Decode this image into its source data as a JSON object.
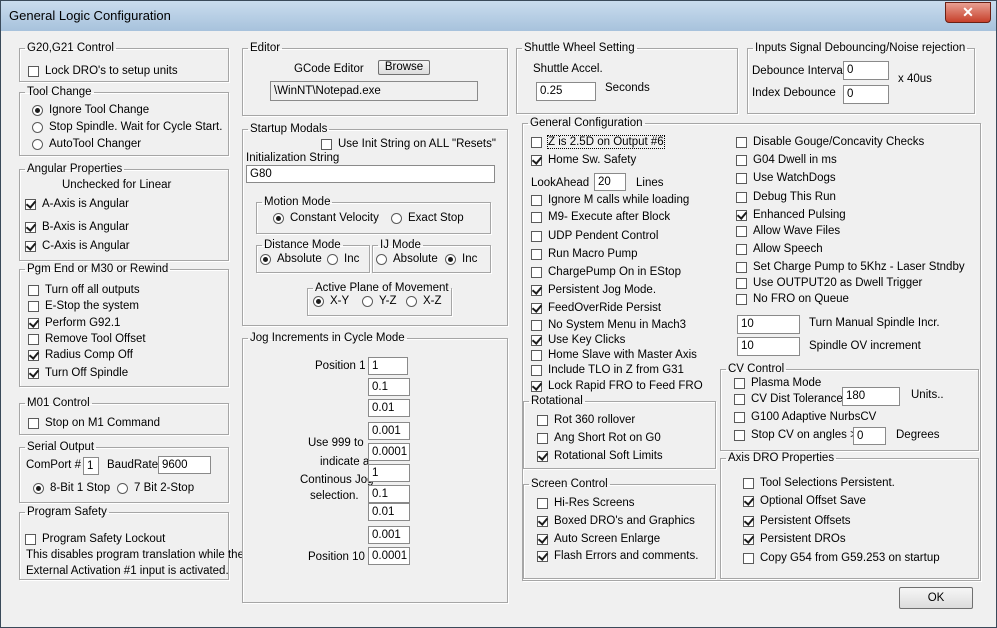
{
  "window": {
    "title": "General Logic Configuration",
    "close_label": "✕"
  },
  "g20": {
    "title": "G20,G21 Control",
    "lock_label": "Lock DRO's to setup units",
    "lock_checked": false
  },
  "toolchange": {
    "title": "Tool Change",
    "options": [
      {
        "label": "Ignore Tool Change",
        "selected": true
      },
      {
        "label": "Stop Spindle. Wait for Cycle Start.",
        "selected": false
      },
      {
        "label": "AutoTool Changer",
        "selected": false
      }
    ]
  },
  "angular": {
    "title": "Angular Properties",
    "note": "Unchecked for Linear",
    "items": [
      {
        "label": "A-Axis is Angular",
        "checked": true
      },
      {
        "label": "B-Axis is Angular",
        "checked": true
      },
      {
        "label": "C-Axis is Angular",
        "checked": true
      }
    ]
  },
  "pgmend": {
    "title": "Pgm End or M30 or Rewind",
    "items": [
      {
        "label": "Turn off all outputs",
        "checked": false
      },
      {
        "label": "E-Stop the system",
        "checked": false
      },
      {
        "label": "Perform G92.1",
        "checked": true
      },
      {
        "label": "Remove Tool Offset",
        "checked": false
      },
      {
        "label": "Radius Comp Off",
        "checked": true
      },
      {
        "label": "Turn Off Spindle",
        "checked": true
      }
    ]
  },
  "m01": {
    "title": "M01 Control",
    "label": "Stop on M1 Command",
    "checked": false
  },
  "serial": {
    "title": "Serial Output",
    "comport_label": "ComPort #",
    "comport_value": "1",
    "baud_label": "BaudRate",
    "baud_value": "9600",
    "options": [
      {
        "label": "8-Bit 1 Stop",
        "selected": true
      },
      {
        "label": "7 Bit 2-Stop",
        "selected": false
      }
    ]
  },
  "safety": {
    "title": "Program Safety",
    "label": "Program Safety Lockout",
    "checked": false,
    "note1": "This disables program translation while the",
    "note2": "External Activation #1 input is activated."
  },
  "editor": {
    "title": "Editor",
    "label": "GCode Editor",
    "browse_label": "Browse",
    "path": "\\WinNT\\Notepad.exe"
  },
  "startup": {
    "title": "Startup Modals",
    "init_all_label": "Use Init String on ALL  \"Resets\"",
    "init_all_checked": false,
    "init_label": "Initialization String",
    "init_value": "G80",
    "motion": {
      "title": "Motion Mode",
      "options": [
        {
          "label": "Constant Velocity",
          "selected": true
        },
        {
          "label": "Exact Stop",
          "selected": false
        }
      ]
    },
    "distance": {
      "title": "Distance Mode",
      "options": [
        {
          "label": "Absolute",
          "selected": true
        },
        {
          "label": "Inc",
          "selected": false
        }
      ]
    },
    "ij": {
      "title": "IJ Mode",
      "options": [
        {
          "label": "Absolute",
          "selected": false
        },
        {
          "label": "Inc",
          "selected": true
        }
      ]
    },
    "plane": {
      "title": "Active Plane of Movement",
      "options": [
        {
          "label": "X-Y",
          "selected": true
        },
        {
          "label": "Y-Z",
          "selected": false
        },
        {
          "label": "X-Z",
          "selected": false
        }
      ]
    }
  },
  "jog": {
    "title": "Jog Increments in Cycle Mode",
    "pos1_label": "Position 1",
    "pos10_label": "Position 10",
    "note": [
      "Use 999 to",
      "indicate a",
      "Continous Jog",
      "selection."
    ],
    "values": [
      "1",
      "0.1",
      "0.01",
      "0.001",
      "0.0001",
      "1",
      "0.1",
      "0.01",
      "0.001",
      "0.0001"
    ]
  },
  "shuttle": {
    "title": "Shuttle Wheel Setting",
    "accel_label": "Shuttle Accel.",
    "accel_value": "0.25",
    "unit": "Seconds"
  },
  "debounce": {
    "title": "Inputs Signal Debouncing/Noise rejection",
    "interval_label": "Debounce Interval",
    "interval_value": "0",
    "index_label": "Index Debounce",
    "index_value": "0",
    "unit": "x 40us"
  },
  "general": {
    "title": "General Configuration",
    "left": [
      {
        "label": "Z is 2.5D on Output #6",
        "checked": false
      },
      {
        "label": "Home Sw. Safety",
        "checked": true
      }
    ],
    "lookahead_label": "LookAhead",
    "lookahead_value": "20",
    "lookahead_unit": "Lines",
    "left2": [
      {
        "label": "Ignore M calls while loading",
        "checked": false
      },
      {
        "label": "M9- Execute after Block",
        "checked": false
      },
      {
        "label": "UDP Pendent Control",
        "checked": false
      },
      {
        "label": "Run Macro Pump",
        "checked": false
      },
      {
        "label": "ChargePump On in EStop",
        "checked": false
      },
      {
        "label": "Persistent Jog Mode.",
        "checked": true
      },
      {
        "label": "FeedOverRide Persist",
        "checked": true
      },
      {
        "label": "No System Menu in Mach3",
        "checked": false
      },
      {
        "label": "Use Key Clicks",
        "checked": true
      },
      {
        "label": "Home Slave with Master Axis",
        "checked": false
      },
      {
        "label": "Include TLO in Z from G31",
        "checked": false
      },
      {
        "label": "Lock Rapid FRO to Feed FRO",
        "checked": true
      }
    ],
    "right": [
      {
        "label": "Disable Gouge/Concavity Checks",
        "checked": false
      },
      {
        "label": "G04 Dwell in ms",
        "checked": false
      },
      {
        "label": "Use WatchDogs",
        "checked": false
      },
      {
        "label": "Debug This Run",
        "checked": false
      },
      {
        "label": "Enhanced Pulsing",
        "checked": true
      },
      {
        "label": "Allow Wave Files",
        "checked": false
      },
      {
        "label": "Allow Speech",
        "checked": false
      },
      {
        "label": "Set Charge Pump to 5Khz   - Laser Stndby",
        "checked": false
      },
      {
        "label": "Use OUTPUT20 as Dwell Trigger",
        "checked": false
      },
      {
        "label": "No FRO on Queue",
        "checked": false
      }
    ],
    "spindle_incr_value": "10",
    "spindle_incr_label": "Turn Manual Spindle Incr.",
    "spindle_ov_value": "10",
    "spindle_ov_label": "Spindle OV increment"
  },
  "rotational": {
    "title": "Rotational",
    "items": [
      {
        "label": "Rot 360 rollover",
        "checked": false
      },
      {
        "label": "Ang Short Rot on G0",
        "checked": false
      },
      {
        "label": "Rotational Soft Limits",
        "checked": true
      }
    ]
  },
  "screen": {
    "title": "Screen Control",
    "items": [
      {
        "label": "Hi-Res Screens",
        "checked": false
      },
      {
        "label": "Boxed DRO's and Graphics",
        "checked": true
      },
      {
        "label": "Auto Screen Enlarge",
        "checked": true
      },
      {
        "label": "Flash Errors and comments.",
        "checked": true
      }
    ]
  },
  "cv": {
    "title": "CV Control",
    "plasma_label": "Plasma Mode",
    "plasma_checked": false,
    "dist_label": "CV Dist Tolerance",
    "dist_checked": false,
    "dist_value": "180",
    "dist_unit": "Units..",
    "g100_label": "G100 Adaptive NurbsCV",
    "g100_checked": false,
    "stop_label": "Stop CV on angles >",
    "stop_checked": false,
    "stop_value": "0",
    "stop_unit": "Degrees"
  },
  "axisdro": {
    "title": "Axis DRO Properties",
    "items": [
      {
        "label": "Tool Selections Persistent.",
        "checked": false
      },
      {
        "label": "Optional Offset Save",
        "checked": true
      },
      {
        "label": "Persistent Offsets",
        "checked": true
      },
      {
        "label": "Persistent DROs",
        "checked": true
      },
      {
        "label": "Copy G54 from G59.253 on startup",
        "checked": false
      }
    ]
  },
  "ok_label": "OK"
}
